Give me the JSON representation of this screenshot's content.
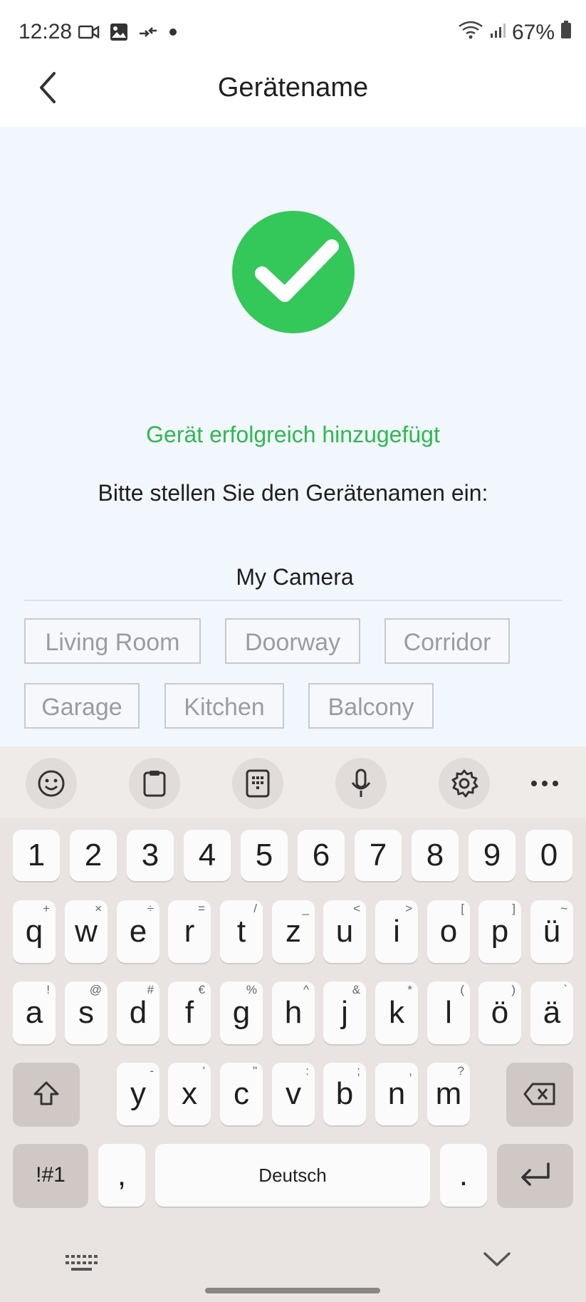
{
  "status_bar": {
    "time": "12:28",
    "battery": "67%"
  },
  "header": {
    "title": "Gerätename"
  },
  "main": {
    "success_text": "Gerät erfolgreich hinzugefügt",
    "prompt_text": "Bitte stellen Sie den Gerätenamen ein:",
    "name_input_value": "My Camera",
    "suggestions": [
      "Living Room",
      "Doorway",
      "Corridor",
      "Garage",
      "Kitchen",
      "Balcony"
    ]
  },
  "keyboard": {
    "number_row": [
      "1",
      "2",
      "3",
      "4",
      "5",
      "6",
      "7",
      "8",
      "9",
      "0"
    ],
    "row1": [
      "q",
      "w",
      "e",
      "r",
      "t",
      "z",
      "u",
      "i",
      "o",
      "p",
      "ü"
    ],
    "row1_hints": [
      "+",
      "×",
      "÷",
      "=",
      "/",
      "_",
      "<",
      ">",
      "[",
      "]",
      "~"
    ],
    "row2": [
      "a",
      "s",
      "d",
      "f",
      "g",
      "h",
      "j",
      "k",
      "l",
      "ö",
      "ä"
    ],
    "row2_hints": [
      "!",
      "@",
      "#",
      "€",
      "%",
      "^",
      "&",
      "*",
      "(",
      ")",
      "`"
    ],
    "row3": [
      "y",
      "x",
      "c",
      "v",
      "b",
      "n",
      "m"
    ],
    "row3_hints": [
      "-",
      "'",
      "\"",
      ":",
      ";",
      ",",
      "?"
    ],
    "symbols_label": "!#1",
    "comma_label": ",",
    "space_label": "Deutsch",
    "period_label": "."
  },
  "colors": {
    "accent_green": "#34c759",
    "success_text": "#2fb84f",
    "content_bg": "#f2f6fd"
  }
}
